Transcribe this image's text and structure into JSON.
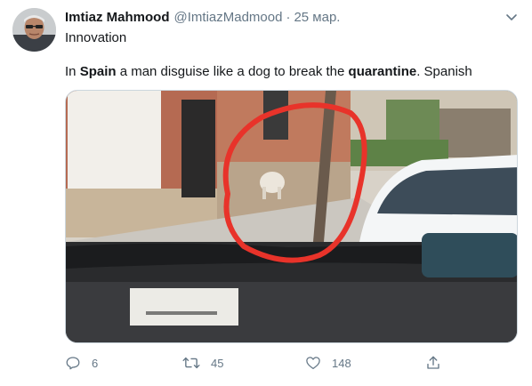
{
  "tweet": {
    "author": {
      "display_name": "Imtiaz Mahmood",
      "handle": "@ImtiazMadmood",
      "avatar_icon": "profile-avatar"
    },
    "separator": "·",
    "time": "25 мар.",
    "subtitle": "Innovation",
    "text": {
      "part1": "In ",
      "bold1": "Spain",
      "part2": " a man disguise like a dog to break the ",
      "bold2": "quarantine",
      "part3": ". Spanish"
    },
    "media": {
      "kind": "photo",
      "overlay_mark": "red-circle",
      "overlay_color": "#e8332a"
    },
    "actions": {
      "reply": {
        "icon": "reply-icon",
        "count": "6"
      },
      "retweet": {
        "icon": "retweet-icon",
        "count": "45"
      },
      "like": {
        "icon": "heart-icon",
        "count": "148"
      },
      "share": {
        "icon": "share-icon"
      }
    },
    "menu_icon": "chevron-down-icon"
  },
  "colors": {
    "primary_text": "#14171a",
    "secondary_text": "#657786",
    "background": "#ffffff"
  }
}
